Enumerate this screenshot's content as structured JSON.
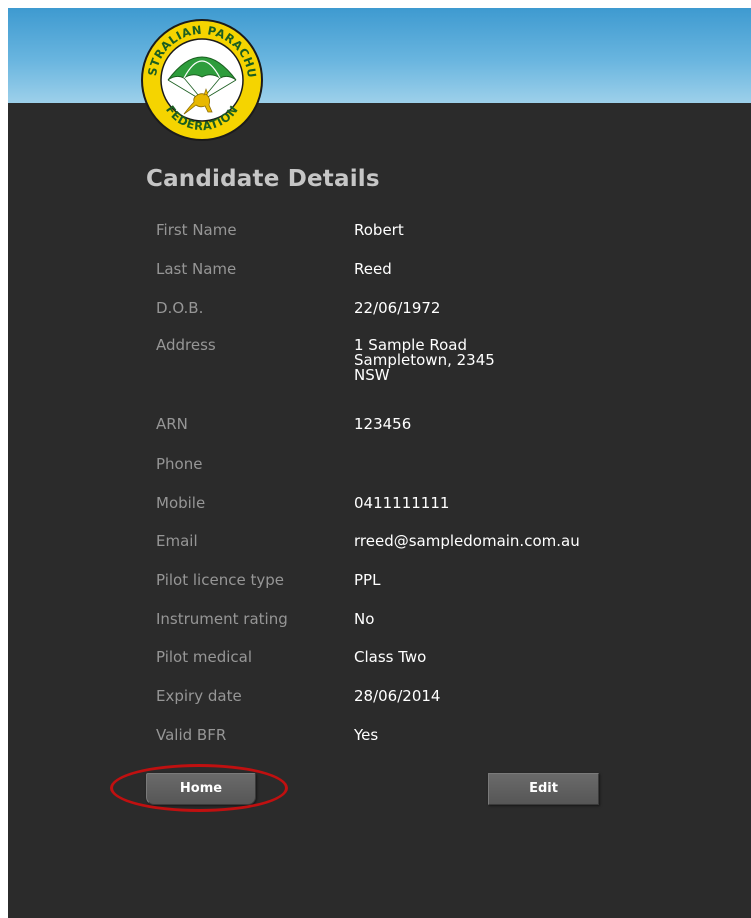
{
  "logo": {
    "text_top": "AUSTRALIAN PARACHUTE",
    "text_bottom": "FEDERATION",
    "colors": {
      "ring": "#f5d400",
      "ring_text": "#1b5e20",
      "canopy": "#2e9d3c",
      "kangaroo": "#e8b800"
    }
  },
  "page": {
    "title": "Candidate Details"
  },
  "details": [
    {
      "label": "First Name",
      "value": "Robert"
    },
    {
      "label": "Last Name",
      "value": "Reed"
    },
    {
      "label": "D.O.B.",
      "value": "22/06/1972"
    },
    {
      "label": "Address",
      "value_lines": [
        "1 Sample Road",
        "Sampletown, 2345",
        "NSW"
      ]
    },
    {
      "label": "ARN",
      "value": "123456"
    },
    {
      "label": "Phone",
      "value": ""
    },
    {
      "label": "Mobile",
      "value": "0411111111"
    },
    {
      "label": "Email",
      "value": "rreed@sampledomain.com.au"
    },
    {
      "label": "Pilot licence type",
      "value": "PPL"
    },
    {
      "label": "Instrument rating",
      "value": "No"
    },
    {
      "label": "Pilot medical",
      "value": "Class Two"
    },
    {
      "label": "Expiry date",
      "value": "28/06/2014"
    },
    {
      "label": "Valid BFR",
      "value": "Yes"
    }
  ],
  "buttons": {
    "home": "Home",
    "edit": "Edit"
  },
  "colors": {
    "background": "#2b2b2b",
    "header_sky": "#5aaedc",
    "label": "#969696",
    "value": "#ffffff",
    "highlight": "#c01010"
  }
}
